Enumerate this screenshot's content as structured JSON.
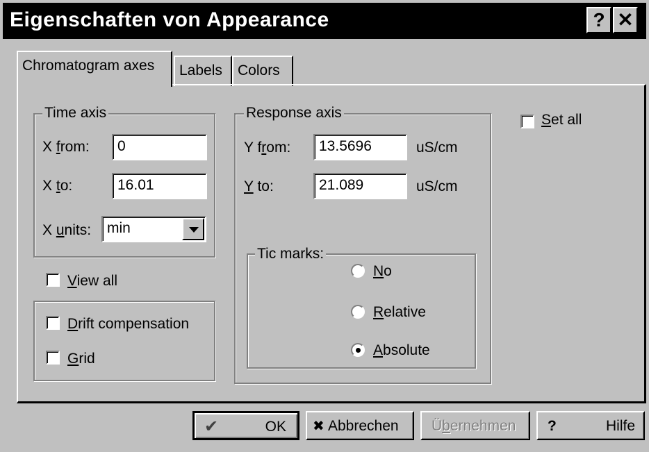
{
  "window": {
    "title": "Eigenschaften von Appearance",
    "help_button": "?",
    "close_button": "✕"
  },
  "tabs": [
    {
      "label": "Chromatogram axes",
      "active": true
    },
    {
      "label": "Labels",
      "active": false
    },
    {
      "label": "Colors",
      "active": false
    }
  ],
  "time_axis": {
    "group_label": "Time axis",
    "x_from_prefix": "X ",
    "x_from_key": "f",
    "x_from_rest": "rom:",
    "x_from_value": "0",
    "x_to_prefix": "X ",
    "x_to_key": "t",
    "x_to_rest": "o:",
    "x_to_value": "16.01",
    "x_units_prefix": "X ",
    "x_units_key": "u",
    "x_units_rest": "nits:",
    "x_units_value": "min"
  },
  "view_all": {
    "key": "V",
    "rest": "iew all",
    "checked": false
  },
  "drift_compensation": {
    "key": "D",
    "rest": "rift compensation",
    "checked": false
  },
  "grid": {
    "key": "G",
    "rest": "rid",
    "checked": false
  },
  "response_axis": {
    "group_label": "Response axis",
    "y_from_prefix": "Y f",
    "y_from_key": "r",
    "y_from_rest": "om:",
    "y_from_value": "13.5696",
    "y_from_unit": "uS/cm",
    "y_to_key": "Y",
    "y_to_rest": " to:",
    "y_to_value": "21.089",
    "y_to_unit": "uS/cm"
  },
  "tic_marks": {
    "group_label": "Tic marks:",
    "options": [
      {
        "key": "N",
        "rest": "o",
        "selected": false
      },
      {
        "key": "R",
        "rest": "elative",
        "selected": false
      },
      {
        "key": "A",
        "rest": "bsolute",
        "selected": true
      }
    ]
  },
  "set_all": {
    "key": "S",
    "rest": "et all",
    "checked": false
  },
  "buttons": {
    "ok": "OK",
    "cancel": "Abbrechen",
    "apply_pre": "Ü",
    "apply_key": "b",
    "apply_rest": "ernehmen",
    "help_icon": "?",
    "help": "Hilfe"
  }
}
